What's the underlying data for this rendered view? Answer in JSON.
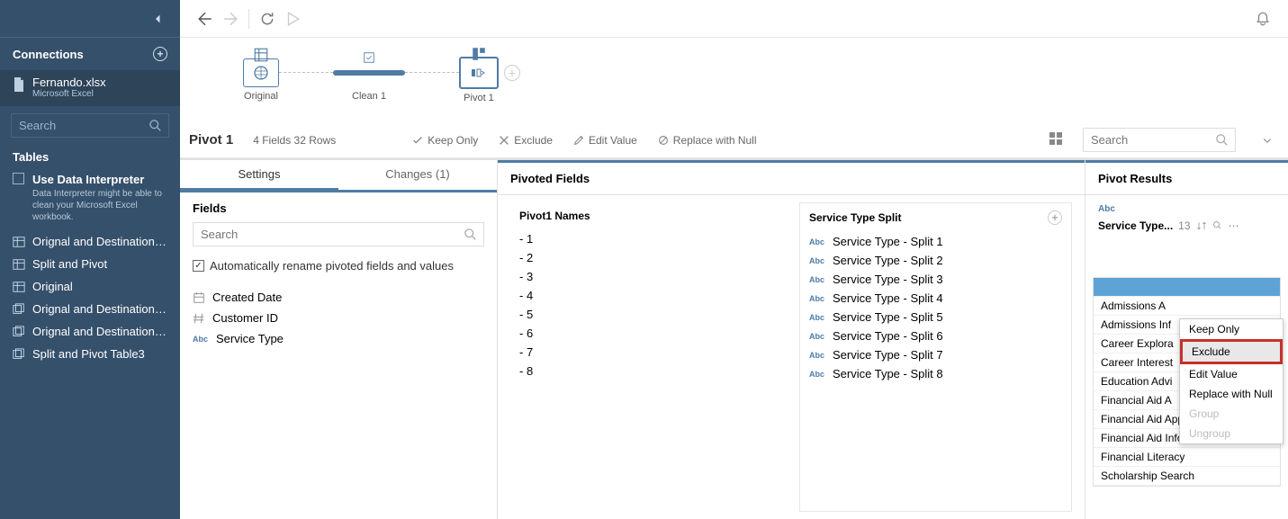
{
  "sidebar": {
    "connections_label": "Connections",
    "file": {
      "name": "Fernando.xlsx",
      "type": "Microsoft Excel"
    },
    "search_placeholder": "Search",
    "tables_label": "Tables",
    "data_interpreter": {
      "title": "Use Data Interpreter",
      "desc": "Data Interpreter might be able to clean your Microsoft Excel workbook."
    },
    "tables": [
      {
        "name": "Orignal and Destination ...",
        "kind": "single"
      },
      {
        "name": "Split and Pivot",
        "kind": "single"
      },
      {
        "name": "Original",
        "kind": "single"
      },
      {
        "name": "Orignal and Destination ...",
        "kind": "multi"
      },
      {
        "name": "Orignal and Destination ...",
        "kind": "multi"
      },
      {
        "name": "Split and Pivot Table3",
        "kind": "multi"
      }
    ]
  },
  "flow": {
    "nodes": [
      {
        "label": "Original"
      },
      {
        "label": "Clean 1"
      },
      {
        "label": "Pivot 1"
      }
    ]
  },
  "crumb": {
    "title": "Pivot 1",
    "info": "4 Fields  32 Rows",
    "actions": {
      "keep": "Keep Only",
      "exclude": "Exclude",
      "edit": "Edit Value",
      "replace": "Replace with Null"
    },
    "search_placeholder": "Search"
  },
  "tabs": {
    "settings": "Settings",
    "changes": "Changes (1)"
  },
  "fields": {
    "header": "Fields",
    "search_placeholder": "Search",
    "auto_rename": "Automatically rename pivoted fields and values",
    "items": [
      {
        "type": "date",
        "name": "Created Date"
      },
      {
        "type": "num",
        "name": "Customer ID"
      },
      {
        "type": "abc",
        "name": "Service Type"
      }
    ]
  },
  "pivoted": {
    "header": "Pivoted Fields",
    "col1_header": "Pivot1 Names",
    "col2_header": "Service Type Split",
    "names": [
      " - 1",
      " - 2",
      " - 3",
      " - 4",
      " - 5",
      " - 6",
      " - 7",
      " - 8"
    ],
    "splits": [
      "Service Type - Split 1",
      "Service Type - Split 2",
      "Service Type - Split 3",
      "Service Type - Split 4",
      "Service Type - Split 5",
      "Service Type - Split 6",
      "Service Type - Split 7",
      "Service Type - Split 8"
    ]
  },
  "results": {
    "header": "Pivot Results",
    "type_label": "Abc",
    "field_name": "Service Type...",
    "count": "13",
    "values": [
      "",
      "Admissions A",
      "Admissions Inf",
      "Career Explora",
      "Career Interest",
      "Education Advi",
      "Financial Aid A",
      "Financial Aid Applicati...",
      "Financial Aid Info",
      "Financial Literacy",
      "Scholarship Search"
    ]
  },
  "context_menu": {
    "keep": "Keep Only",
    "exclude": "Exclude",
    "edit": "Edit Value",
    "replace": "Replace with Null",
    "group": "Group",
    "ungroup": "Ungroup"
  }
}
